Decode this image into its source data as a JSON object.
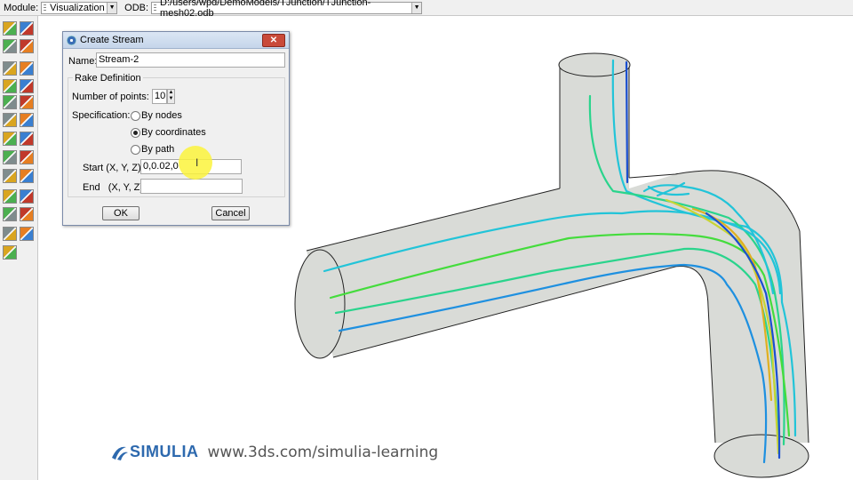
{
  "context_bar": {
    "module_label": "Module:",
    "module_value": "Visualization",
    "odb_label": "ODB:",
    "odb_value": "D:/users/wpd/DemoModels/TJunction/TJunction-mesh02.odb"
  },
  "toolbox": {
    "icons": [
      "section-points-icon",
      "viewport-icon",
      "plot-undeformed-icon",
      "deformed-icon",
      "contour-icon",
      "symbol-icon",
      "material-orientation-icon",
      "plot-allow-multiple-icon",
      "animate-icon",
      "animate-harmonic-icon",
      "xy-data-icon",
      "xy-plot-icon",
      "path-icon",
      "stream-icon",
      "free-body-icon",
      "display-group-icon",
      "view-cut-icon",
      "overlay-icon",
      "probe-icon",
      "query-icon",
      "replace-selected-icon",
      "create-display-group-icon",
      "ply-stack-icon",
      "color-code-icon",
      "tool-icon"
    ]
  },
  "dialog": {
    "title": "Create Stream",
    "name_label": "Name:",
    "name_value": "Stream-2",
    "group_title": "Rake Definition",
    "num_points_label": "Number of points:",
    "num_points_value": "10",
    "spec_label": "Specification:",
    "option_nodes": "By nodes",
    "option_coords": "By coordinates",
    "option_path": "By path",
    "selected_option": "By coordinates",
    "start_label": "Start (X, Y, Z):",
    "start_value": "0,0.02,0",
    "end_label": "End   (X, Y, Z):",
    "end_value": "",
    "ok_label": "OK",
    "cancel_label": "Cancel"
  },
  "watermark": {
    "brand": "SIMULIA",
    "url": "www.3ds.com/simulia-learning"
  },
  "colors": {
    "pipe_fill": "#d9dbd7",
    "streams": [
      "#1a4fd0",
      "#1e90e0",
      "#22c4d8",
      "#2ad48c",
      "#44dc3c",
      "#c7d435",
      "#e0b020"
    ]
  }
}
